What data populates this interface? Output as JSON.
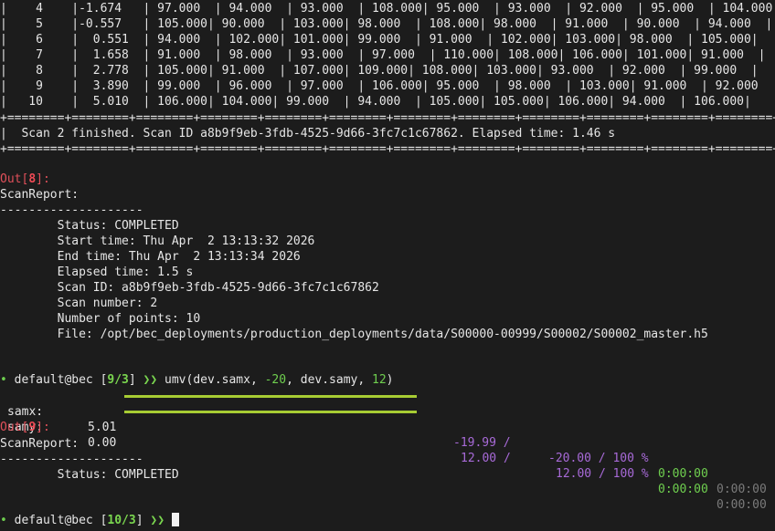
{
  "table": {
    "rows": [
      "|    4    |-1.674   | 97.000  | 94.000  | 93.000  | 108.000| 95.000  | 93.000  | 92.000  | 95.000  | 104.000|",
      "|    5    |-0.557   | 105.000| 90.000  | 103.000| 98.000  | 108.000| 98.000  | 91.000  | 90.000  | 94.000  |",
      "|    6    |  0.551  | 94.000  | 102.000| 101.000| 99.000  | 91.000  | 102.000| 103.000| 98.000  | 105.000|",
      "|    7    |  1.658  | 91.000  | 98.000  | 93.000  | 97.000  | 110.000| 108.000| 106.000| 101.000| 91.000  |",
      "|    8    |  2.778  | 105.000| 91.000  | 107.000| 109.000| 108.000| 103.000| 93.000  | 92.000  | 99.000  |",
      "|    9    |  3.890  | 99.000  | 96.000  | 97.000  | 106.000| 95.000  | 98.000  | 103.000| 91.000  | 92.000  |",
      "|   10    |  5.010  | 106.000| 104.000| 99.000  | 94.000  | 105.000| 105.000| 106.000| 94.000  | 106.000|"
    ],
    "separator": "+========+========+========+========+========+========+========+========+========+========+========+========+",
    "finished_line": "|  Scan 2 finished. Scan ID a8b9f9eb-3fdb-4525-9d66-3fc7c1c67862. Elapsed time: 1.46 s                        |"
  },
  "out8": {
    "prefix": "Out[",
    "number": "8",
    "suffix": "]:"
  },
  "report1": {
    "title": "ScanReport:",
    "divider": "--------------------",
    "lines": [
      "        Status: COMPLETED",
      "        Start time: Thu Apr  2 13:13:32 2026",
      "        End time: Thu Apr  2 13:13:34 2026",
      "        Elapsed time: 1.5 s",
      "        Scan ID: a8b9f9eb-3fdb-4525-9d66-3fc7c1c67862",
      "        Scan number: 2",
      "        Number of points: 10",
      "        File: /opt/bec_deployments/production_deployments/data/S00000-00999/S00002/S00002_master.h5"
    ]
  },
  "prompt1": {
    "bullet": "•",
    "user": "default@bec",
    "counter_open": "[",
    "counter": "9/3",
    "counter_close": "]",
    "arrows": "❯❯",
    "cmd_start": "umv(dev.samx, ",
    "arg1": "-20",
    "cmd_mid": ", dev.samy, ",
    "arg2": "12",
    "cmd_end": ")"
  },
  "motors": [
    {
      "name": "samx:",
      "value": "5.01",
      "progress": 1.0,
      "current": "-19.99 /",
      "target": "-20.00 / 100 %",
      "elapsed": "0:00:00",
      "remaining": "0:00:00"
    },
    {
      "name": "samy:",
      "value": "0.00",
      "progress": 1.0,
      "current": "12.00 /",
      "target": "12.00 / 100 %",
      "elapsed": "0:00:00",
      "remaining": "0:00:00"
    }
  ],
  "out9": {
    "prefix": "Out[",
    "number": "9",
    "suffix": "]:"
  },
  "report2": {
    "title": "ScanReport:",
    "divider": "--------------------",
    "status": "        Status: COMPLETED"
  },
  "prompt2": {
    "bullet": "•",
    "user": "default@bec",
    "counter_open": "[",
    "counter": "10/3",
    "counter_close": "]",
    "arrows": "❯❯"
  },
  "colors": {
    "background": "#1c1c1c",
    "text": "#e6e6e6",
    "out_red": "#e0505a",
    "prompt_green": "#6fcf4f",
    "progress_bar": "#a7cc33",
    "motor_values_purple": "#a86ad8",
    "time_dim": "#7a7a7a"
  }
}
